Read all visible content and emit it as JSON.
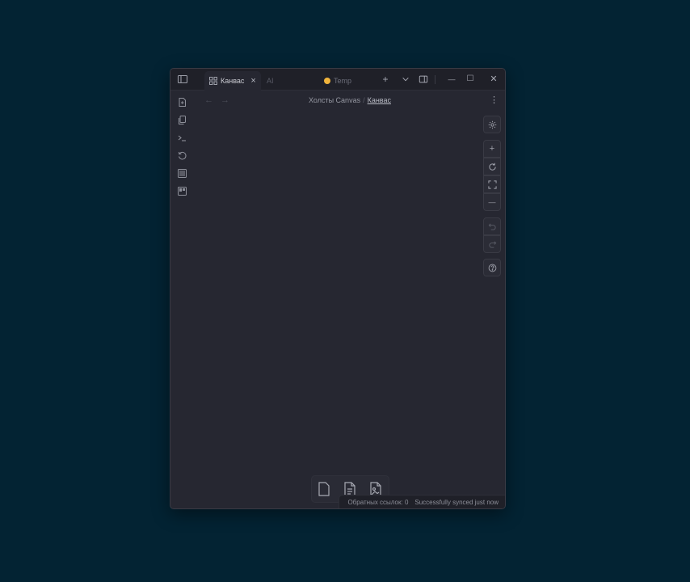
{
  "tabs": [
    {
      "label": "Канвас",
      "active": true,
      "close": "×"
    },
    {
      "label": "AI",
      "active": false
    },
    {
      "label": "Temp",
      "active": false
    }
  ],
  "titlebar": {
    "new_tab": "+",
    "dropdown": "⌄",
    "minimize": "—",
    "maximize": "☐",
    "close": "✕"
  },
  "nav": {
    "back": "←",
    "forward": "→",
    "more": "⋮"
  },
  "breadcrumb": {
    "parent": "Холсты Canvas",
    "separator": "/",
    "current": "Канвас"
  },
  "canvas_controls": {
    "zoom_in": "+",
    "zoom_out": "—"
  },
  "status": {
    "backlinks": "Обратных ссылок: 0",
    "sync": "Successfully synced just now"
  },
  "colors": {
    "background": "#032333",
    "window": "#262731",
    "titlebar": "#1f2028",
    "temp_dot": "#f0b43c"
  }
}
